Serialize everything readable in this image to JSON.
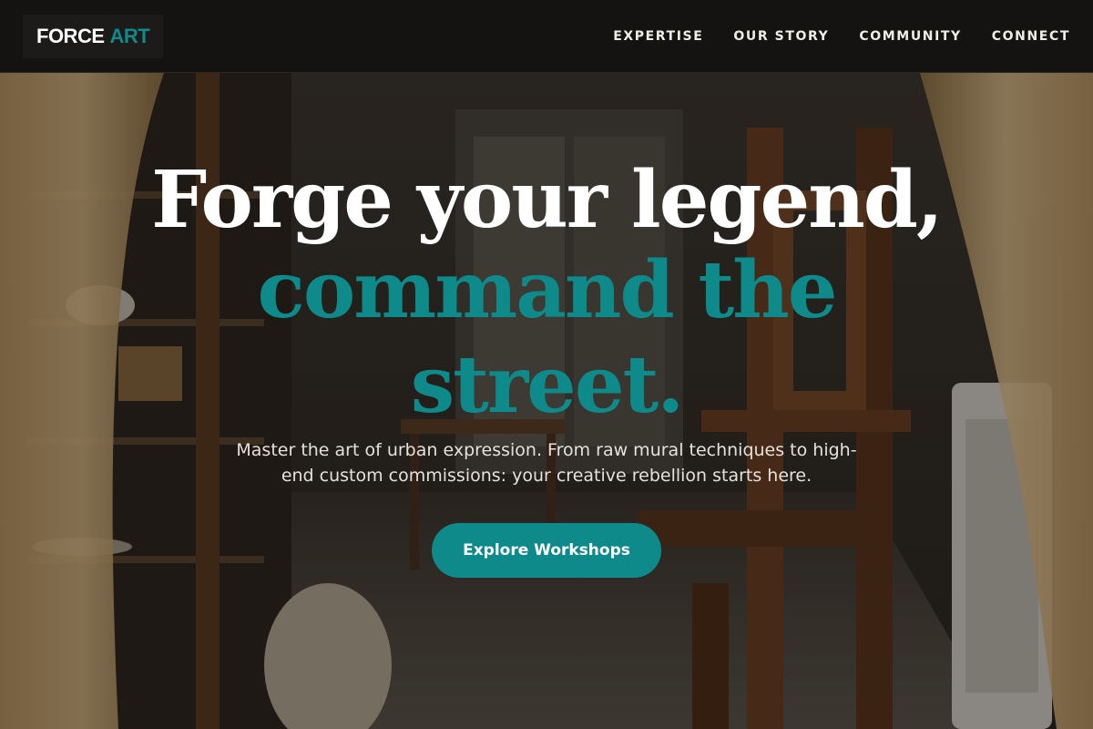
{
  "brand": {
    "part1": "FORCE",
    "part2": "ART"
  },
  "nav": [
    {
      "label": "EXPERTISE"
    },
    {
      "label": "OUR STORY"
    },
    {
      "label": "COMMUNITY"
    },
    {
      "label": "CONNECT"
    }
  ],
  "hero": {
    "headline_line1": "Forge your legend,",
    "headline_line2": "command the",
    "headline_line3": "street.",
    "subtitle": "Master the art of urban expression. From raw mural techniques to high-end custom commissions: your creative rebellion starts here.",
    "cta_label": "Explore Workshops"
  },
  "colors": {
    "accent": "#0f8a8a",
    "navbar": "#141312",
    "text": "#ffffff"
  }
}
